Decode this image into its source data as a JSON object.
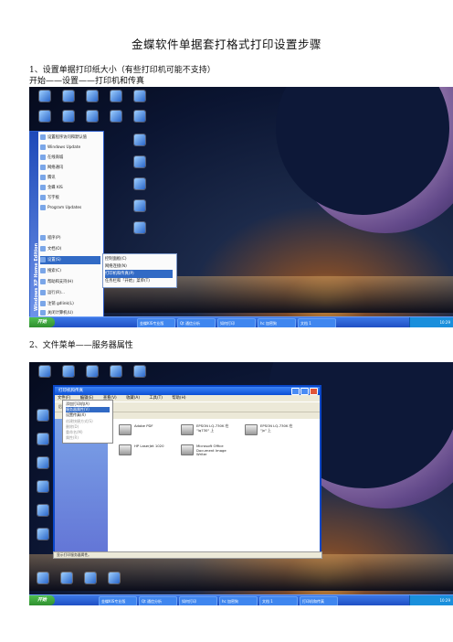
{
  "doc": {
    "title": "金蝶软件单据套打格式打印设置步骤",
    "step1_heading": "1、设置单据打印纸大小（有些打印机可能不支持）",
    "step1_path": "开始——设置——打印机和传真",
    "step2_heading": "2、文件菜单——服务器属性"
  },
  "shot1": {
    "start_menu_strip": "Windows XP Home Edition",
    "menu_items": [
      "设置程序访问和默认值",
      "Windows Update",
      "在线商城",
      "网络通讯",
      "腾讯",
      "金蝶 KIS",
      "写字板",
      "Program Updates",
      "程序(P)",
      "文档(O)",
      "设置(S)",
      "搜索(C)",
      "帮助和支持(H)",
      "运行(R)...",
      "注销 gdlink(L)",
      "关闭计算机(U)"
    ],
    "submenu_items": [
      "控制面板(C)",
      "网络连接(N)",
      "打印机和传真(P)",
      "任务栏和「开始」菜单(T)"
    ],
    "start_label": "开始",
    "tasks": [
      "金蝶KIS专业版",
      "Qt 通信分析",
      "如何打印",
      "hc 加密狗",
      "文档 1"
    ],
    "clock": "10:29"
  },
  "shot2": {
    "window_title": "打印机和传真",
    "menubar": [
      "文件(F)",
      "编辑(E)",
      "查看(V)",
      "收藏(A)",
      "工具(T)",
      "帮助(H)"
    ],
    "toolbar": "后退 · 搜索 · 文件夹",
    "file_menu": [
      "添加打印机(A)",
      "服务器属性(V)",
      "设置传真(X)",
      "创建快捷方式(S)",
      "删除(D)",
      "重命名(M)",
      "属性(R)",
      "关闭(C)"
    ],
    "printers": [
      "Adobe PDF",
      "EPSON LQ-730K 在 \"lq730\" 上",
      "EPSON LQ-730K 在 \"jx\" 上",
      "HP LaserJet 1020",
      "Microsoft Office Document Image Writer"
    ],
    "status": "显示打印服务器属性。",
    "start_label": "开始",
    "tasks": [
      "金蝶KIS专业版",
      "Qt 通信分析",
      "如何打印",
      "hc 加密狗",
      "文档 1",
      "打印机和传真"
    ],
    "clock": "10:29"
  }
}
